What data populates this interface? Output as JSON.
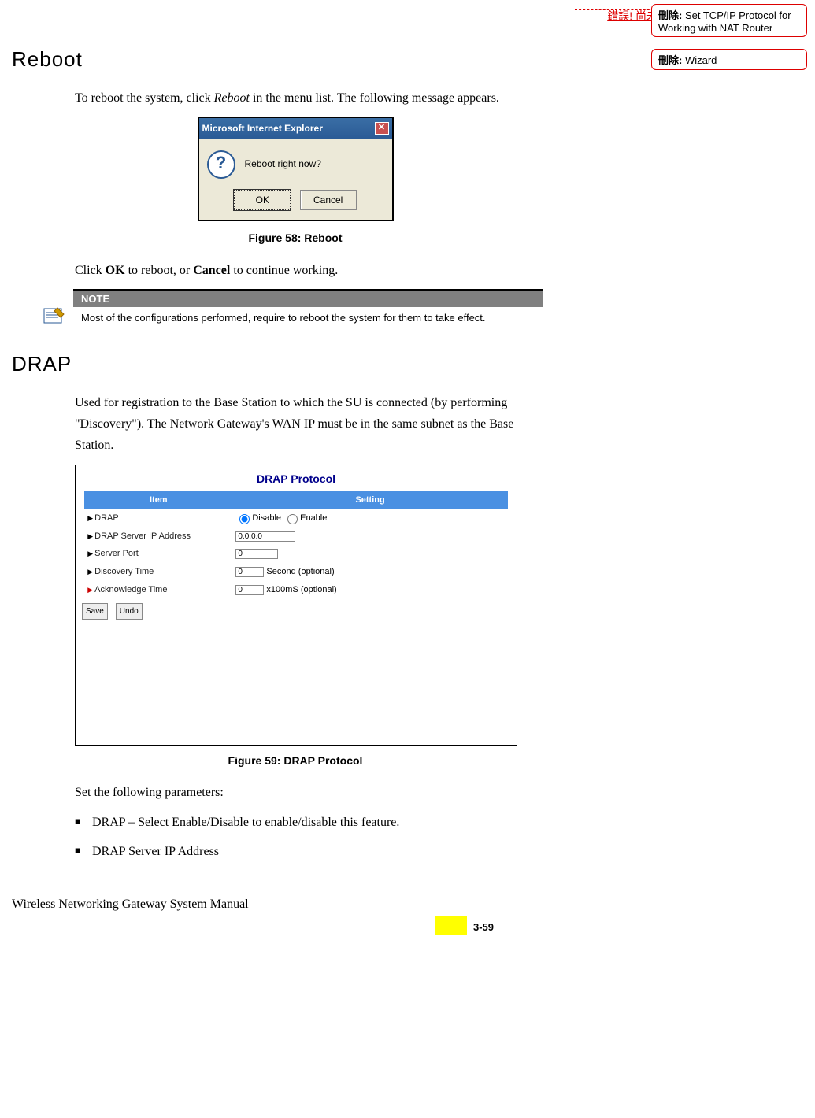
{
  "header": {
    "error_text": "錯誤! 尚未定義樣式。"
  },
  "comments": [
    {
      "label": "刪除:",
      "text": "Set TCP/IP Protocol for Working with NAT Router"
    },
    {
      "label": "刪除:",
      "text": "Wizard"
    }
  ],
  "section1": {
    "title": "Reboot",
    "p1_a": "To reboot the system, click ",
    "p1_em": "Reboot",
    "p1_b": " in the menu list. The following message appears.",
    "dialog": {
      "title": "Microsoft Internet Explorer",
      "question": "Reboot right now?",
      "ok": "OK",
      "cancel": "Cancel",
      "close_glyph": "✕",
      "q_glyph": "?"
    },
    "fig_caption": "Figure 58: Reboot",
    "p2_a": "Click ",
    "p2_b1": "OK",
    "p2_c": " to reboot, or ",
    "p2_b2": "Cancel",
    "p2_d": " to continue working."
  },
  "note": {
    "header": "NOTE",
    "body": "Most of the configurations performed, require to reboot the system for them to take effect."
  },
  "section2": {
    "title": "DRAP",
    "p1": "Used for registration to the Base Station to which the SU is connected (by performing \"Discovery\"). The Network Gateway's WAN IP must be in the same subnet as the Base Station.",
    "drap": {
      "heading": "DRAP Protocol",
      "col1": "Item",
      "col2": "Setting",
      "rows": [
        {
          "label": "DRAP",
          "disable": "Disable",
          "enable": "Enable"
        },
        {
          "label": "DRAP Server IP Address",
          "value": "0.0.0.0"
        },
        {
          "label": "Server Port",
          "value": "0"
        },
        {
          "label": "Discovery Time",
          "value": "0",
          "unit": "Second (optional)"
        },
        {
          "label": "Acknowledge Time",
          "value": "0",
          "unit": "x100mS (optional)"
        }
      ],
      "save": "Save",
      "undo": "Undo"
    },
    "fig_caption": "Figure 59: DRAP Protocol",
    "p2": "Set the following parameters:",
    "bullets": [
      "DRAP – Select Enable/Disable to enable/disable this feature.",
      "DRAP Server IP Address"
    ]
  },
  "footer": {
    "text": "Wireless Networking Gateway System Manual",
    "page": "3-59"
  }
}
